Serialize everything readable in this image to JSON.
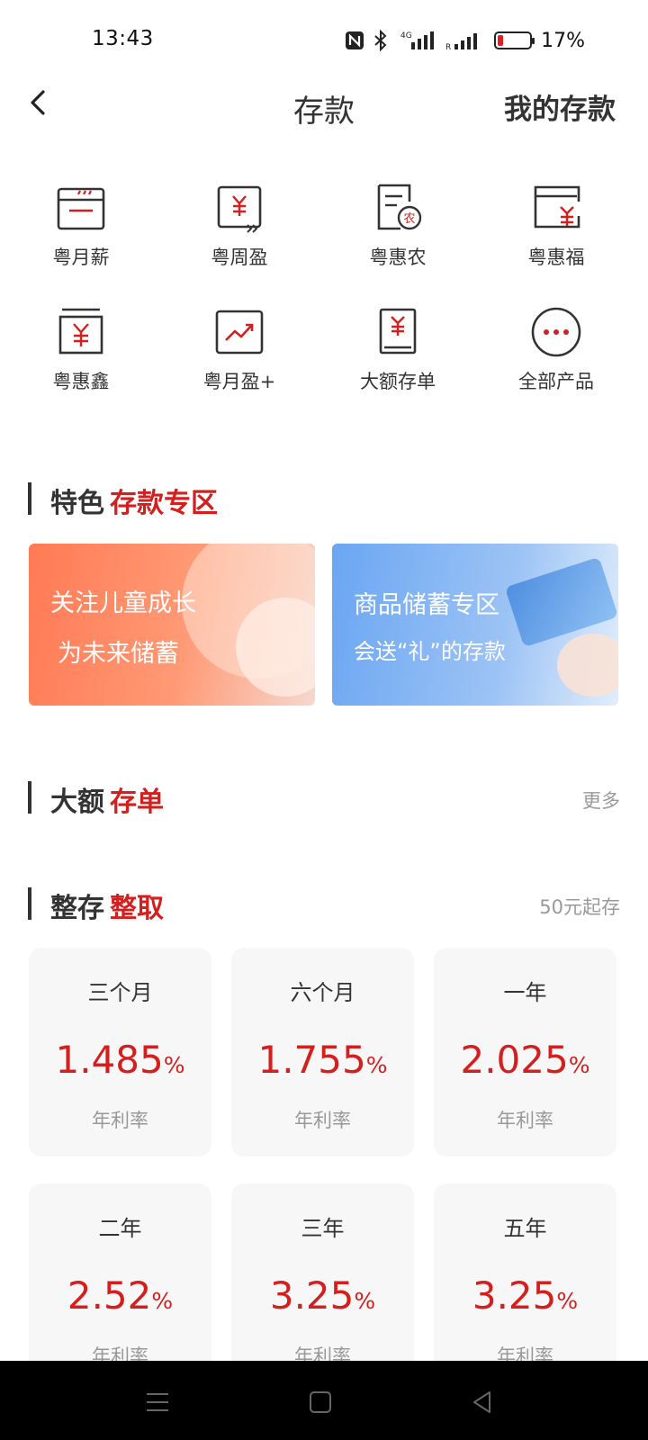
{
  "status_bar": {
    "time": "13:43",
    "battery_text": "17%",
    "battery_level": 0.17,
    "network_label": "4G",
    "roaming_label": "R"
  },
  "header": {
    "title": "存款",
    "right_action": "我的存款"
  },
  "products": [
    {
      "label": "粤月薪",
      "icon": "salary-card-icon"
    },
    {
      "label": "粤周盈",
      "icon": "yen-weekly-icon"
    },
    {
      "label": "粤惠农",
      "icon": "agri-document-icon",
      "icon_badge": "农"
    },
    {
      "label": "粤惠福",
      "icon": "yen-wallet-icon"
    },
    {
      "label": "粤惠鑫",
      "icon": "yen-box-icon"
    },
    {
      "label": "粤月盈+",
      "icon": "trend-chart-icon"
    },
    {
      "label": "大额存单",
      "icon": "yen-certificate-icon"
    },
    {
      "label": "全部产品",
      "icon": "more-dots-icon"
    }
  ],
  "featured": {
    "title_black": "特色",
    "title_red": "存款专区",
    "banners": [
      {
        "line1": "关注儿童成长",
        "line2": "为未来储蓄"
      },
      {
        "line1": "商品储蓄专区",
        "line2": "会送“礼”的存款"
      }
    ]
  },
  "large_cd": {
    "title_black": "大额",
    "title_red": "存单",
    "more": "更多"
  },
  "fixed": {
    "title_black": "整存",
    "title_red": "整取",
    "note": "50元起存",
    "rate_label": "年利率",
    "percent_sign": "%",
    "cards": [
      {
        "term": "三个月",
        "rate": "1.485"
      },
      {
        "term": "六个月",
        "rate": "1.755"
      },
      {
        "term": "一年",
        "rate": "2.025"
      },
      {
        "term": "二年",
        "rate": "2.52"
      },
      {
        "term": "三年",
        "rate": "3.25"
      },
      {
        "term": "五年",
        "rate": "3.25"
      }
    ]
  },
  "colors": {
    "accent_red": "#d41f1f",
    "text_dark": "#333333",
    "text_muted": "#999999",
    "card_bg": "#f7f7f7"
  }
}
